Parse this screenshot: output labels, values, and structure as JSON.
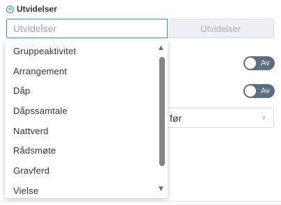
{
  "header": {
    "title": "Utvidelser",
    "icon": "plus-circle-icon"
  },
  "search": {
    "placeholder": "Utvidelser",
    "value": "",
    "button_label": "Utvidelser"
  },
  "toggles": [
    {
      "label": "Av",
      "state": "off"
    },
    {
      "label": "Av",
      "state": "off"
    }
  ],
  "select": {
    "value": "før"
  },
  "dropdown": {
    "options": [
      "Gruppeaktivitet",
      "Arrangement",
      "Dåp",
      "Dåpssamtale",
      "Nattverd",
      "Rådsmøte",
      "Gravferd",
      "Vielse"
    ]
  },
  "colors": {
    "accent": "#2e9c8f",
    "toggle_off": "#5b6f80",
    "scrollbar_thumb": "#858585"
  }
}
